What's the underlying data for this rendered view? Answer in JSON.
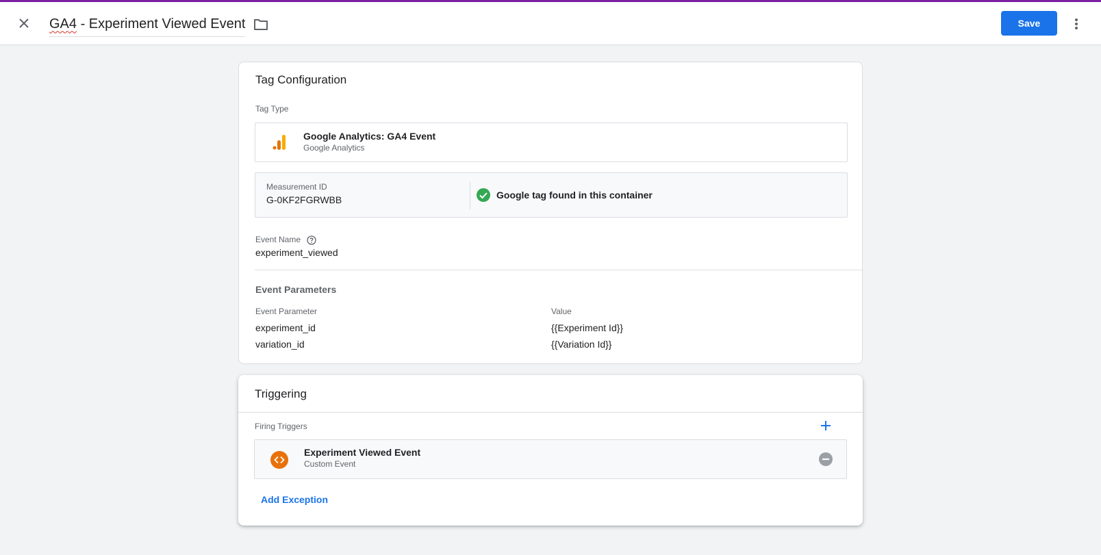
{
  "header": {
    "title_spellcheck": "GA4",
    "title_rest": " - Experiment Viewed Event",
    "save_label": "Save"
  },
  "tag_config": {
    "title": "Tag Configuration",
    "tag_type_label": "Tag Type",
    "tag_type_name": "Google Analytics: GA4 Event",
    "tag_type_vendor": "Google Analytics",
    "measurement_id_label": "Measurement ID",
    "measurement_id": "G-0KF2FGRWBB",
    "google_tag_status": "Google tag found in this container",
    "event_name_label": "Event Name",
    "event_name": "experiment_viewed",
    "event_params_title": "Event Parameters",
    "param_col_header": "Event Parameter",
    "value_col_header": "Value",
    "params": [
      {
        "name": "experiment_id",
        "value": "{{Experiment Id}}"
      },
      {
        "name": "variation_id",
        "value": "{{Variation Id}}"
      }
    ]
  },
  "triggering": {
    "title": "Triggering",
    "firing_label": "Firing Triggers",
    "trigger_name": "Experiment Viewed Event",
    "trigger_type": "Custom Event",
    "add_exception_label": "Add Exception"
  },
  "colors": {
    "accent": "#1a73e8",
    "top_line": "#7b1fa2",
    "success": "#34a853",
    "trigger_icon": "#e8710a",
    "analytics_dark": "#e37400",
    "analytics_light": "#f9ab00"
  },
  "icons": [
    "close-icon",
    "folder-icon",
    "more-vert-icon",
    "analytics-icon",
    "check-circle-icon",
    "help-icon",
    "add-icon",
    "custom-event-icon",
    "remove-circle-icon"
  ]
}
